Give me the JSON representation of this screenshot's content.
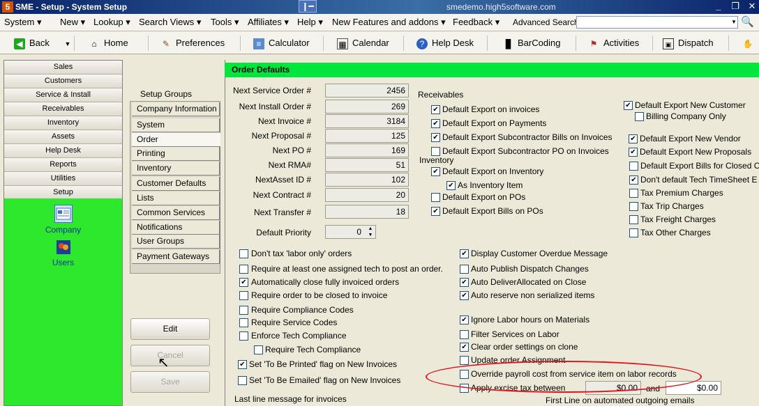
{
  "window": {
    "title": "SME - Setup - System Setup",
    "host": "smedemo.high5software.com",
    "app_icon_text": "5",
    "pin_icon": "pin-icon",
    "controls": [
      "_",
      "❐",
      "✕"
    ]
  },
  "menubar": {
    "items": [
      {
        "label": "System",
        "has_arrow": true
      },
      {
        "label": "New",
        "has_arrow": true
      },
      {
        "label": "Lookup",
        "has_arrow": true
      },
      {
        "label": "Search Views",
        "has_arrow": true
      },
      {
        "label": "Tools",
        "has_arrow": true
      },
      {
        "label": "Affiliates",
        "has_arrow": true
      },
      {
        "label": "Help",
        "has_arrow": true
      },
      {
        "label": "New Features and addons",
        "has_arrow": true
      },
      {
        "label": "Feedback",
        "has_arrow": true
      }
    ],
    "advanced_search_label": "Advanced Search",
    "advanced_search_value": ""
  },
  "toolbar": {
    "back": "Back",
    "home": "Home",
    "preferences": "Preferences",
    "calculator": "Calculator",
    "calendar": "Calendar",
    "help_desk": "Help Desk",
    "barcoding": "BarCoding",
    "activities": "Activities",
    "dispatch": "Dispatch"
  },
  "leftnav": {
    "items": [
      "Sales",
      "Customers",
      "Service & Install",
      "Receivables",
      "Inventory",
      "Assets",
      "Help Desk",
      "Reports",
      "Utilities",
      "Setup"
    ],
    "sub_items": [
      "Company",
      "Users"
    ]
  },
  "setup_groups": {
    "label": "Setup Groups",
    "items": [
      "Company Information",
      "System",
      "Order",
      "Printing",
      "Inventory",
      "Customer Defaults",
      "Lists",
      "Common Services",
      "Notifications",
      "User Groups",
      "Payment Gateways"
    ],
    "selected": "Order"
  },
  "buttons": {
    "edit": "Edit",
    "cancel": "Cancel",
    "save": "Save"
  },
  "panel": {
    "header": "Order Defaults",
    "numbers": [
      {
        "label": "Next Service Order #",
        "value": "2456"
      },
      {
        "label": "Next Install Order #",
        "value": "269"
      },
      {
        "label": "Next Invoice #",
        "value": "3184"
      },
      {
        "label": "Next Proposal #",
        "value": "125"
      },
      {
        "label": "Next PO #",
        "value": "169"
      },
      {
        "label": "Next RMA#",
        "value": "51"
      },
      {
        "label": "NextAsset ID #",
        "value": "102"
      },
      {
        "label": "Next Contract #",
        "value": "20"
      },
      {
        "label": "Next Transfer #",
        "value": "18"
      }
    ],
    "default_priority_label": "Default Priority",
    "default_priority_value": "0",
    "receivables_label": "Receivables",
    "inventory_label": "Inventory",
    "receivables_checks": [
      {
        "label": "Default Export on invoices",
        "checked": true
      },
      {
        "label": "Default Export on Payments",
        "checked": true
      },
      {
        "label": "Default Export Subcontractor Bills on Invoices",
        "checked": true
      },
      {
        "label": "Default Export Subcontractor PO on Invoices",
        "checked": false
      }
    ],
    "inventory_checks": [
      {
        "label": "Default Export on Inventory",
        "checked": true
      },
      {
        "label": "As Inventory Item",
        "checked": true
      },
      {
        "label": "Default Export on POs",
        "checked": false
      },
      {
        "label": "Default Export Bills on POs",
        "checked": true
      }
    ],
    "right_checks": [
      {
        "label": "Default Export New Customer",
        "checked": true
      },
      {
        "label": "Billing Company Only",
        "checked": false
      },
      {
        "label": "Default Export New Vendor",
        "checked": true
      },
      {
        "label": "Default Export New Proposals",
        "checked": true
      },
      {
        "label": "Default Export Bills for Closed O",
        "checked": false
      },
      {
        "label": "Don't default Tech TimeSheet E",
        "checked": true
      },
      {
        "label": "Tax Premium Charges",
        "checked": false
      },
      {
        "label": "Tax Trip Charges",
        "checked": false
      },
      {
        "label": "Tax Freight Charges",
        "checked": false
      },
      {
        "label": "Tax Other Charges",
        "checked": false
      }
    ],
    "left_checks": [
      {
        "label": "Don't tax 'labor only' orders",
        "checked": false
      },
      {
        "label": "Require at least one assigned tech to post an order.",
        "checked": false
      },
      {
        "label": "Automatically close fully invoiced orders",
        "checked": true
      },
      {
        "label": "Require order to be closed to invoice",
        "checked": false
      },
      {
        "label": "Require Compliance Codes",
        "checked": false
      },
      {
        "label": "Require Service Codes",
        "checked": false
      },
      {
        "label": "Enforce Tech Compliance",
        "checked": false
      },
      {
        "label": "Require Tech Compliance",
        "checked": false
      },
      {
        "label": "Set 'To Be Printed' flag on New Invoices",
        "checked": true
      },
      {
        "label": "Set 'To Be Emailed' flag on New Invoices",
        "checked": false
      }
    ],
    "mid_checks": [
      {
        "label": "Display Customer Overdue Message",
        "checked": true
      },
      {
        "label": "Auto Publish Dispatch Changes",
        "checked": false
      },
      {
        "label": "Auto DeliverAllocated on Close",
        "checked": true
      },
      {
        "label": "Auto reserve non serialized items",
        "checked": true
      },
      {
        "label": "Ignore Labor hours on Materials",
        "checked": true
      },
      {
        "label": "Filter Services on Labor",
        "checked": false
      },
      {
        "label": "Clear order settings on clone",
        "checked": true
      },
      {
        "label": "Update order Assignment",
        "checked": false
      },
      {
        "label": "Override payroll cost from service item on labor records",
        "checked": false
      },
      {
        "label": "Apply excise tax between",
        "checked": false
      }
    ],
    "excise_from": "$0.00",
    "excise_and": "and",
    "excise_to": "$0.00",
    "last_line_label": "Last line message for invoices",
    "first_line_label": "First Line on automated outgoing emails"
  },
  "colors": {
    "header_green": "#00e63d",
    "nav_green": "#2ee82e",
    "highlight_ellipse": "#e0141a"
  }
}
